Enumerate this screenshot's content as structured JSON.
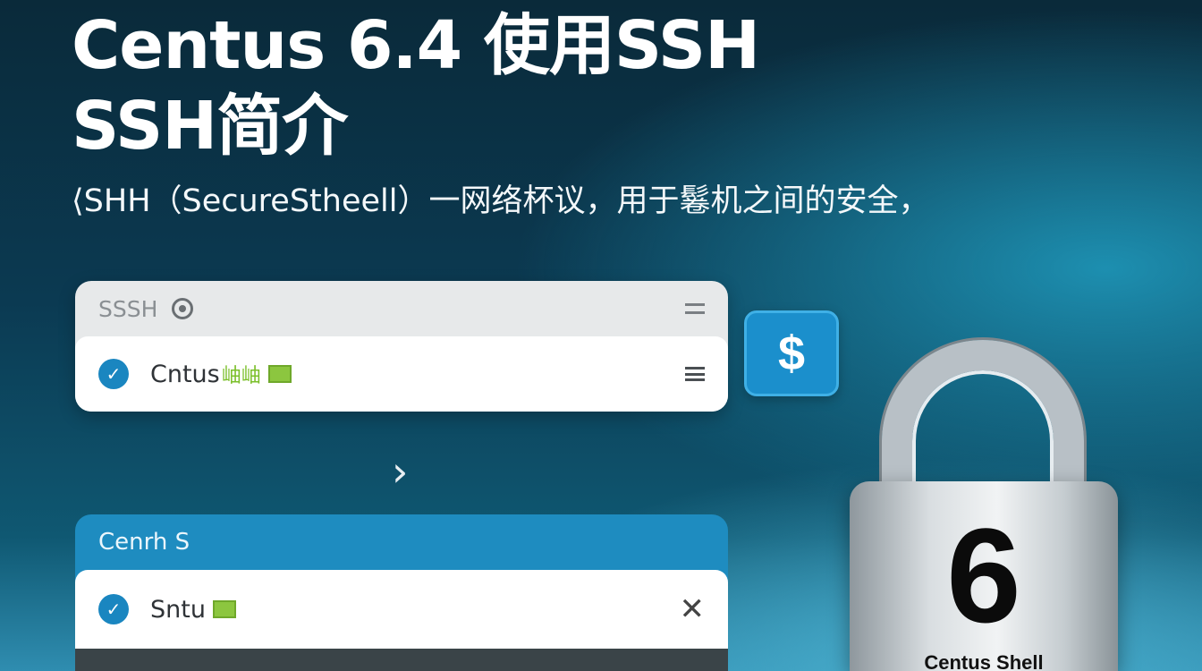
{
  "headline": {
    "line1": "Centus 6.4 使用SSH",
    "line2": "SSH简介"
  },
  "subtitle": "⟨SHH（SecureStheell）一网络杯议，用于鬈机之间的安全，",
  "card1": {
    "header_title": "SSSH",
    "header_icon": "info-icon",
    "menu_icon": "menu-icon",
    "row": {
      "icon": "check-icon",
      "label": "Cntus",
      "tag": "岫岫"
    }
  },
  "dollar_button": {
    "label": "$",
    "color": "#1b8fcc"
  },
  "chevron": "›",
  "card2": {
    "header_title": "Cenrh S",
    "row": {
      "icon": "check-icon",
      "label": "Sntu",
      "close": "✕"
    },
    "color": "#1e8cc0"
  },
  "lock": {
    "digit": "6",
    "caption": "Centus Shell"
  },
  "colors": {
    "accent": "#1a86c0",
    "green": "#8cc63f"
  }
}
